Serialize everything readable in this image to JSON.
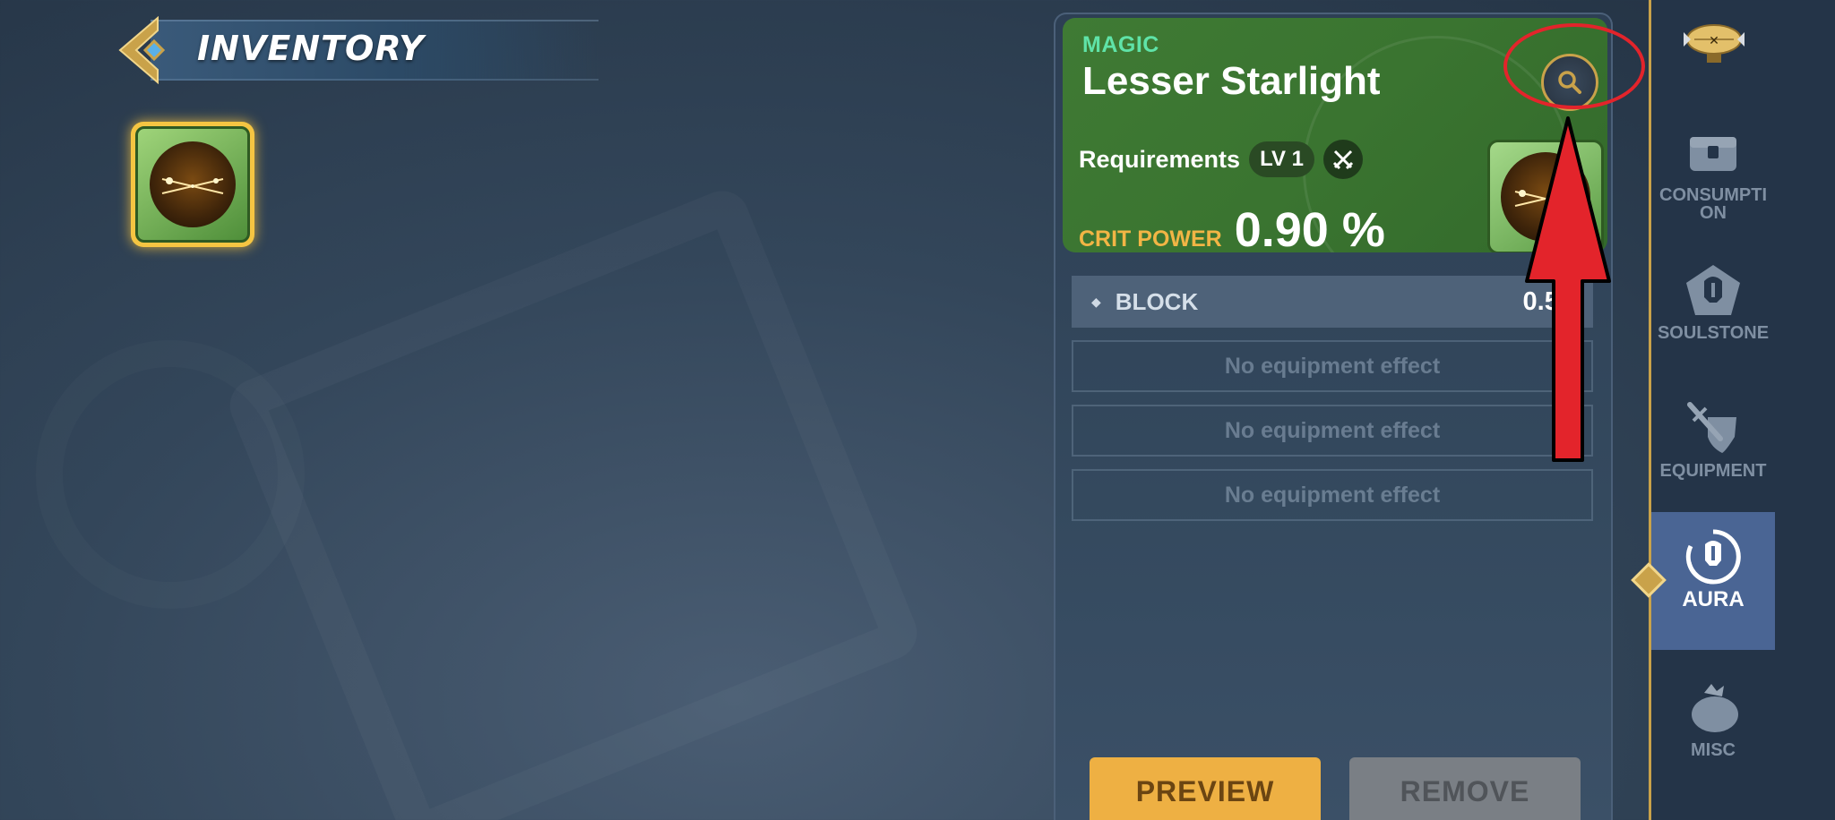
{
  "header": {
    "title": "INVENTORY"
  },
  "inventory": {
    "items": [
      {
        "name": "Lesser Starlight",
        "selected": true
      }
    ]
  },
  "detail": {
    "type": "MAGIC",
    "name": "Lesser Starlight",
    "requirements_label": "Requirements",
    "level": "LV 1",
    "main_stat": {
      "label": "CRIT POWER",
      "value": "0.90 %"
    },
    "effects": [
      {
        "name": "BLOCK",
        "value": "0.50"
      }
    ],
    "empty_effects": [
      "No equipment effect",
      "No equipment effect",
      "No equipment effect"
    ],
    "preview_label": "PREVIEW",
    "remove_label": "REMOVE"
  },
  "sidebar": {
    "items": [
      {
        "label": "CONSUMPTI ON",
        "icon": "chest-icon",
        "active": false
      },
      {
        "label": "SOULSTONE",
        "icon": "soulstone-icon",
        "active": false
      },
      {
        "label": "EQUIPMENT",
        "icon": "sword-shield-icon",
        "active": false
      },
      {
        "label": "AURA",
        "icon": "aura-icon",
        "active": true
      },
      {
        "label": "MISC",
        "icon": "bag-icon",
        "active": false
      }
    ]
  },
  "colors": {
    "accent_gold": "#c9a24a",
    "magic_green": "#5fe3a8",
    "stat_orange": "#f2b545",
    "highlight_red": "#e3242b"
  }
}
